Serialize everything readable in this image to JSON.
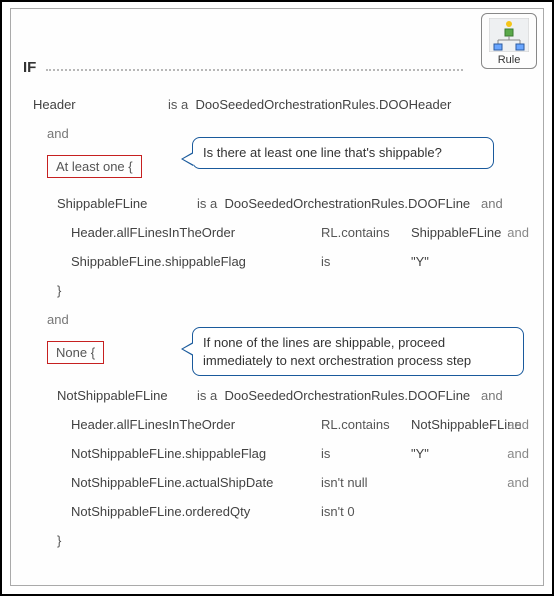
{
  "badge": {
    "label": "Rule"
  },
  "header": {
    "if": "IF"
  },
  "callouts": {
    "c1": "Is there at least one line that's shippable?",
    "c2": "If none of the lines are shippable, proceed immediately to next orchestration process step"
  },
  "ops": {
    "is_a": "is a",
    "and": "and",
    "is": "is",
    "rlcontains": "RL.contains",
    "isnt_null": "isn't null",
    "isnt_0": "isn't 0"
  },
  "quant": {
    "atleastone": "At least one  {",
    "none": "None  {",
    "close": "}"
  },
  "vals": {
    "y": "\"Y\""
  },
  "b1": {
    "var": "Header",
    "type": "DooSeededOrchestrationRules.DOOHeader"
  },
  "s1": {
    "var": "ShippableFLine",
    "type": "DooSeededOrchestrationRules.DOOFLine",
    "cond1_lhs": "Header.allFLinesInTheOrder",
    "cond1_rhs": "ShippableFLine",
    "cond2_lhs": "ShippableFLine.shippableFlag"
  },
  "s2": {
    "var": "NotShippableFLine",
    "type": "DooSeededOrchestrationRules.DOOFLine",
    "cond1_lhs": "Header.allFLinesInTheOrder",
    "cond1_rhs": "NotShippableFLine",
    "cond2_lhs": "NotShippableFLine.shippableFlag",
    "cond3_lhs": "NotShippableFLine.actualShipDate",
    "cond4_lhs": "NotShippableFLine.orderedQty"
  }
}
